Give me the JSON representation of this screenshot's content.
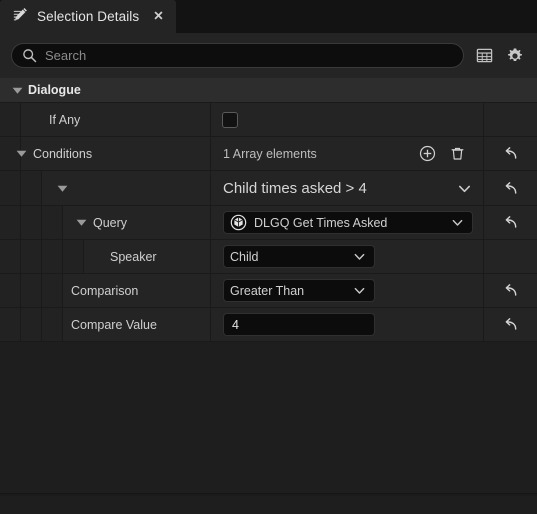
{
  "tab": {
    "title": "Selection Details",
    "icon": "details-pencil-icon",
    "close_label": "✕"
  },
  "search": {
    "placeholder": "Search",
    "value": "",
    "icon": "search-icon"
  },
  "toolbar": {
    "columns_icon": "table-columns-icon",
    "settings_icon": "gear-icon"
  },
  "category": {
    "label": "Dialogue"
  },
  "rows": {
    "if_any": {
      "label": "If Any",
      "checked": false
    },
    "conditions": {
      "label": "Conditions",
      "value": "1 Array elements",
      "add_icon": "plus-circle-icon",
      "delete_icon": "trash-icon",
      "reset_icon": "reset-arrow-icon"
    },
    "element": {
      "label": "",
      "summary": "Child times asked > 4"
    },
    "query": {
      "label": "Query",
      "value": "DLGQ Get Times Asked",
      "class_icon": "blueprint-class-icon"
    },
    "speaker": {
      "label": "Speaker",
      "value": "Child"
    },
    "comparison": {
      "label": "Comparison",
      "value": "Greater Than"
    },
    "compare_value": {
      "label": "Compare Value",
      "value": "4"
    }
  },
  "colors": {
    "panel_bg": "#1e1e1e",
    "row_bg": "#242424",
    "category_bg": "#2d2d2d",
    "field_bg": "#0c0c0c",
    "text": "#d0d0d0",
    "tabbar_bg": "#131313"
  }
}
